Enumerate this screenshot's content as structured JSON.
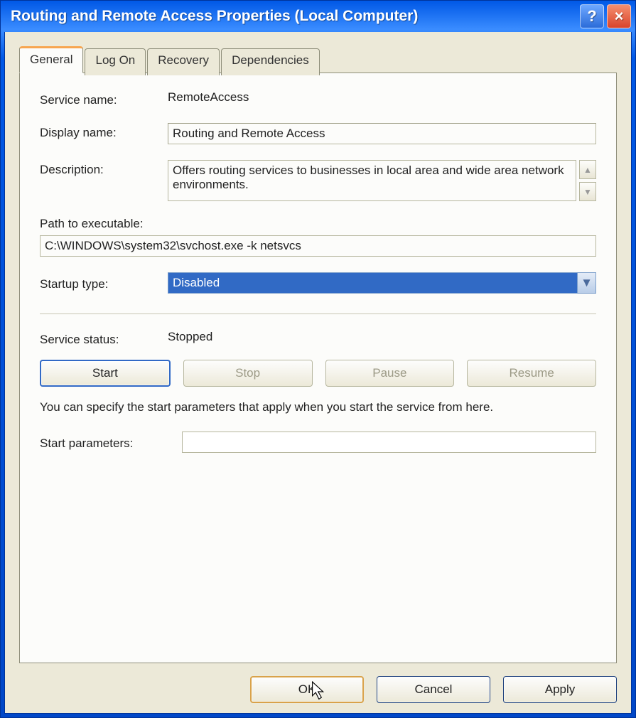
{
  "title": "Routing and Remote Access Properties (Local Computer)",
  "tabs": {
    "general": "General",
    "logon": "Log On",
    "recovery": "Recovery",
    "dependencies": "Dependencies"
  },
  "labels": {
    "service_name": "Service name:",
    "display_name": "Display name:",
    "description": "Description:",
    "path_to_exe": "Path to executable:",
    "startup_type": "Startup type:",
    "service_status": "Service status:",
    "start_params": "Start parameters:"
  },
  "values": {
    "service_name": "RemoteAccess",
    "display_name": "Routing and Remote Access",
    "description": "Offers routing services to businesses in local area and wide area network environments.",
    "path_to_exe": "C:\\WINDOWS\\system32\\svchost.exe -k netsvcs",
    "startup_type": "Disabled",
    "service_status": "Stopped",
    "start_params": ""
  },
  "buttons": {
    "start": "Start",
    "stop": "Stop",
    "pause": "Pause",
    "resume": "Resume",
    "ok": "OK",
    "cancel": "Cancel",
    "apply": "Apply"
  },
  "hint": "You can specify the start parameters that apply when you start the service from here.",
  "titlebar_help": "?",
  "titlebar_close": "×"
}
